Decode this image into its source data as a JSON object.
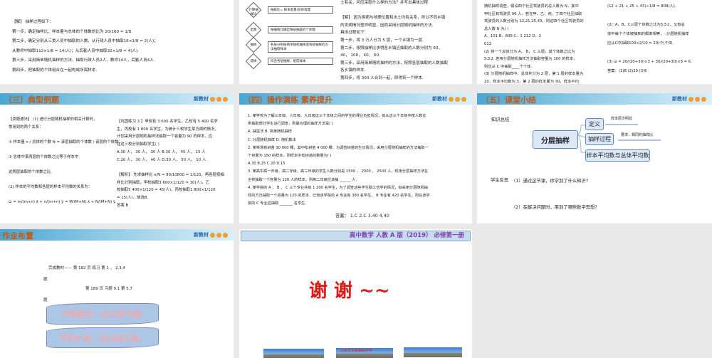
{
  "slide1": {
    "lines": [
      "【解】  抽样过程如下：",
      "第一步，确定抽样比，样本量与总体的个体数的比为 20/160 = 1/8.",
      "第二步，确定分别从三类人员中抽取的人数，从行政人员中抽取16×1/8 = 2(人)；",
      "从教师中抽取112×1/8 = 14(人)；从后勤人员中抽取32×1/8 = 4(人).",
      "第三步，采用简单随机抽样的方法，抽取行政人员2人，教师14人，后勤人员4人.",
      "第四步，把抽取的个体组合在一起构成所需样本."
    ]
  },
  "slide2": {
    "flow": [
      {
        "node": "计算抽样比",
        "box": "抽样比= 样本容量/总体容量"
      },
      {
        "node": "定数",
        "box": "按抽样比确定每层抽取的个体数"
      },
      {
        "node": "抽样",
        "box": "各层分别按简单随机抽样或系统抽样的方法抽取样本"
      },
      {
        "node": "成样",
        "box": "综合各层抽样，组成样本"
      }
    ],
    "lines": [
      "土有关，问应采取什么样的方法？并写出具体过程.",
      "",
      "【解】  因为疾病与地理位置和水土均有关系，所以不同乡镇",
      "的发病情况差异明显，因而采用分层随机抽样的方法.",
      "具体过程如下：",
      "第一步，将 3 万人分为 5 层，一个乡镇为一层.",
      "第二步，按照抽样比求得各乡镇应抽取的人数分别为 60，",
      "40， 100， 40， 60.",
      "第三步，采用简单随机抽样的方法，按照各层抽取的人数抽取",
      "各乡镇的样本.",
      "第四步，将 300 人合到一起，即得到一个样本."
    ]
  },
  "slide3": {
    "left": [
      "随机抽样调查，假设四个社区驾驶员的总人数为 N，其中",
      "甲社区有驾驶员 96 人．若在甲、乙、丙、丁四个社区抽取",
      "驾驶员的人数分别为 12,21,25,43，则这四个社区驾驶员的",
      "总人数 N 为(     )",
      "A．101        B．808        C．1 212        D．2",
      "012",
      "(2) 将一个总体分为 A， B， C 三层，其个体数之比为",
      "5∶3∶2. 若用分层随机抽样方法抽取容量为 100 的样本，",
      "则应从 C 中抽取____个个体.",
      "(3) 分层随机抽样中，总体共分为 2 层，第 1 层的样本量为",
      "20，样本平均数为 3，第 2 层的样本量为 30，样本平均"
    ],
    "right": [
      "(12 + 21 + 25 + 43)÷1/8 = 808(人).",
      "",
      "(2)∵A，B，C三层个体数之比为5∶3∶2，又有总",
      "体中每个个体被抽到的概率相等，∴分层随机抽样",
      "应从C中抽取100×2/10 = 20(个)个体.",
      "",
      "(3)  ω̄ = 20/(20+30)×3 + 30/(20+30)×8 = 6.",
      "答案：(1)B   (2)20   (3)6"
    ]
  },
  "brand": {
    "label": "新教材"
  },
  "slide4": {
    "title": "（三）典型例题",
    "left": [
      "【类题通法】 (1) 进行分层随机抽样的相关计算时，",
      "常用到的两个关系：",
      "",
      "① 样本量 n / 总体的个数 N = 该层抽取的个体数 / 该层的个体数；",
      "",
      "② 总体中某两层的个体数之比等于样本中",
      "",
      "这两层抽取的个体数之比.",
      "",
      "(2) 样本的平均数和各层的样本平均数的关系为：",
      "",
      "ω̄ = m/(m+n) x̄ + n/(m+n) ȳ = M/(M+N) x̄ + N/(M+N) ȳ."
    ],
    "right": [
      "【巩固练习 3 】甲校有 3 600 名学生，乙校有 5 400 名学",
      "生，丙校有 1 800 名学生，为统计三校学生某方面的情况，",
      "计划采用分层随机抽样法抽取一个容量为 90 的样本，应",
      "在这三校分别抽取学生(     )",
      "A.30 人， 30 人， 30 人    B.30 人， 45 人， 15 人",
      "C.20 人， 30 人， 40 人    D.30 人， 50 人， 10 人",
      "",
      "【解析】  先求抽样比 n/N = 90/10800 = 1/120，再各层按抽",
      "样比分别抽取，甲校抽取3 600×1/120 = 30(人)，乙",
      "校抽取5 400×1/120 = 45(人)，丙校抽取1 800×1/120",
      "= 15(人)，故选B.",
      "答案  B"
    ]
  },
  "slide5": {
    "title": "（四）操作演练 素养提升",
    "lines": [
      "1. 某学校为了解三年级、六年级、九年级这三个年级之间的学生的课业负担情况，拟从这三个年级中按人数比",
      "例抽取部分学生进行调查，则最合理的抽样方法是(     )",
      "A. 抽签法                         B. 简单随机抽样",
      "C. 分层随机抽样                  D. 随机数法",
      "2. 某林场有树苗 30 000 棵，其中松树苗 4 000 棵．为调查树苗的生长情况，采用分层随机抽样的方法抽取一",
      "个容量为 150 的样本，则样本中松树苗的数量为(     )",
      "A.30      B.25      C.20      D.15",
      "3. 某高中高一年级、高二年级、高三年级的学生人数分别是 1500 、 2000 、 2500 人，现用分层抽样方法在",
      "全校抽取一个容量为 120 人的样本，则高二年级应该抽 ______ 人.",
      "4. 某学院的 A ， B ， C 三个专业共有 1 200 名学生，为了调查这些学生勤工俭学的情况，拟采用分层随机抽",
      "样的方法抽取一个容量为 120 的样本．已知该学院的 A 专业有 380 名学生， B 专业有 420 名学生，则在该学",
      "院的 C 专业应抽取 _______ 名学生."
    ],
    "answer": "答案：  1.C      2.C    3.40    4.40"
  },
  "slide6": {
    "title": "（五）课堂小结",
    "summary_label": "知识总结",
    "center": "分层抽样",
    "branches": [
      "定义",
      "抽样过程",
      "样本平均数与总体平均数"
    ],
    "notes": [
      "样本层次明显",
      "要求：相同的抽样比"
    ],
    "reflect_label": "学生反思",
    "q1": "（1）通过这节课，你学到了什么知识?",
    "q2": "（2）在解决问题时，用到了哪些数学思想?"
  },
  "slide7": {
    "title": "作业布置",
    "line1": "完成教材—— 第 182 页  练习    第 1 ， 2,3,4",
    "ti1": "题",
    "line2": "第 189 页   习题 9.1   第 5,7",
    "ti2": "题",
    "banner1": "不积跬步，无以至千里;",
    "banner2": "不积小流，无以成江海。"
  },
  "slide8": {
    "header": "高中数学    人教 A 版（2019）  必修第一册",
    "thanks": "谢  谢  ~~",
    "school": "山东沂水县第四中学"
  }
}
